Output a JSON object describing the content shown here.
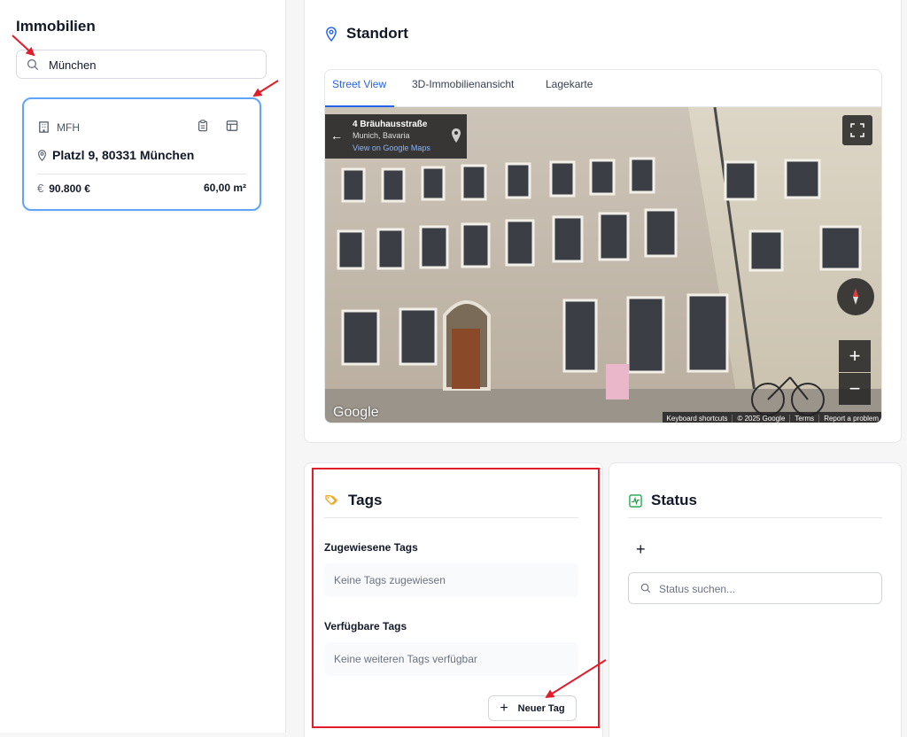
{
  "sidebar": {
    "title": "Immobilien",
    "search": {
      "value": "München",
      "icon": "search-icon"
    }
  },
  "property_card": {
    "type": "MFH",
    "address": "Platzl 9, 80331 München",
    "currency_symbol": "€",
    "price": "90.800 €",
    "area": "60,00 m²"
  },
  "standort": {
    "title": "Standort",
    "tabs": [
      {
        "label": "Street View",
        "active": true
      },
      {
        "label": "3D-Immobilienansicht",
        "active": false
      },
      {
        "label": "Lagekarte",
        "active": false
      }
    ],
    "street_view": {
      "street": "4 Bräuhausstraße",
      "city": "Munich, Bavaria",
      "maps_link": "View on Google Maps",
      "back_arrow": "←",
      "zoom_in": "+",
      "zoom_out": "−",
      "logo": "Google",
      "footer": [
        "Keyboard shortcuts",
        "© 2025 Google",
        "Terms",
        "Report a problem"
      ]
    }
  },
  "tags": {
    "title": "Tags",
    "assigned_label": "Zugewiesene Tags",
    "assigned_empty": "Keine Tags zugewiesen",
    "available_label": "Verfügbare Tags",
    "available_empty": "Keine weiteren Tags verfügbar",
    "new_tag_plus": "+",
    "new_tag_label": "Neuer Tag"
  },
  "status": {
    "title": "Status",
    "add_symbol": "+",
    "search_placeholder": "Status suchen..."
  },
  "colors": {
    "accent": "#2563eb",
    "card_highlight": "#60a5fa",
    "annotation_red": "#e11d2b",
    "tag_icon": "#f59e0b",
    "status_icon": "#16a34a"
  }
}
